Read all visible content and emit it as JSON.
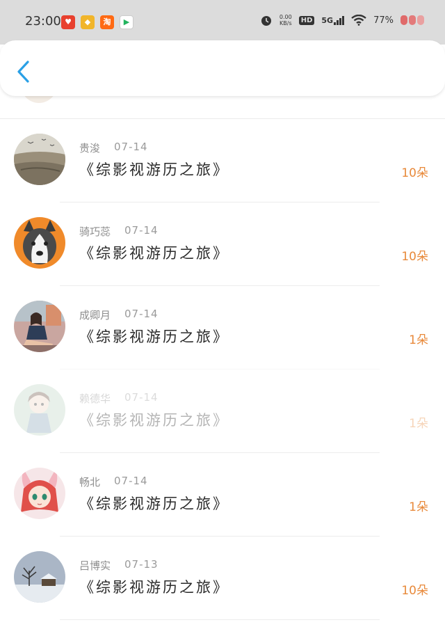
{
  "status_bar": {
    "time": "23:00",
    "apps": [
      {
        "icon": "heart-app-icon",
        "glyph": "♥",
        "color": "#e8402e"
      },
      {
        "icon": "chat-app-icon",
        "glyph": "◆",
        "color": "#f1b52a"
      },
      {
        "icon": "taobao-app-icon",
        "glyph": "淘",
        "color": "#ff6a13"
      },
      {
        "icon": "video-app-icon",
        "glyph": "▶",
        "color": "#22b35e"
      }
    ],
    "net_speed": "0.00",
    "net_unit": "KB/s",
    "hd": "HD",
    "network": "5G",
    "battery": "77%"
  },
  "header": {
    "back_icon": "chevron-left-icon",
    "accent_color": "#2aa0e6"
  },
  "list": [
    {
      "name": "贵浚",
      "date": "07-14",
      "title": "《综影视游历之旅》",
      "amount": "10朵",
      "avatar": "sea-avatar",
      "faded": false
    },
    {
      "name": "骑巧蕊",
      "date": "07-14",
      "title": "《综影视游历之旅》",
      "amount": "10朵",
      "avatar": "husky-avatar",
      "faded": false
    },
    {
      "name": "成卿月",
      "date": "07-14",
      "title": "《综影视游历之旅》",
      "amount": "1朵",
      "avatar": "girl-avatar",
      "faded": false
    },
    {
      "name": "赖德华",
      "date": "07-14",
      "title": "《综影视游历之旅》",
      "amount": "1朵",
      "avatar": "doll-avatar",
      "faded": true
    },
    {
      "name": "畅北",
      "date": "07-14",
      "title": "《综影视游历之旅》",
      "amount": "1朵",
      "avatar": "anime-avatar",
      "faded": false
    },
    {
      "name": "吕博实",
      "date": "07-13",
      "title": "《综影视游历之旅》",
      "amount": "10朵",
      "avatar": "winter-avatar",
      "faded": false
    }
  ]
}
